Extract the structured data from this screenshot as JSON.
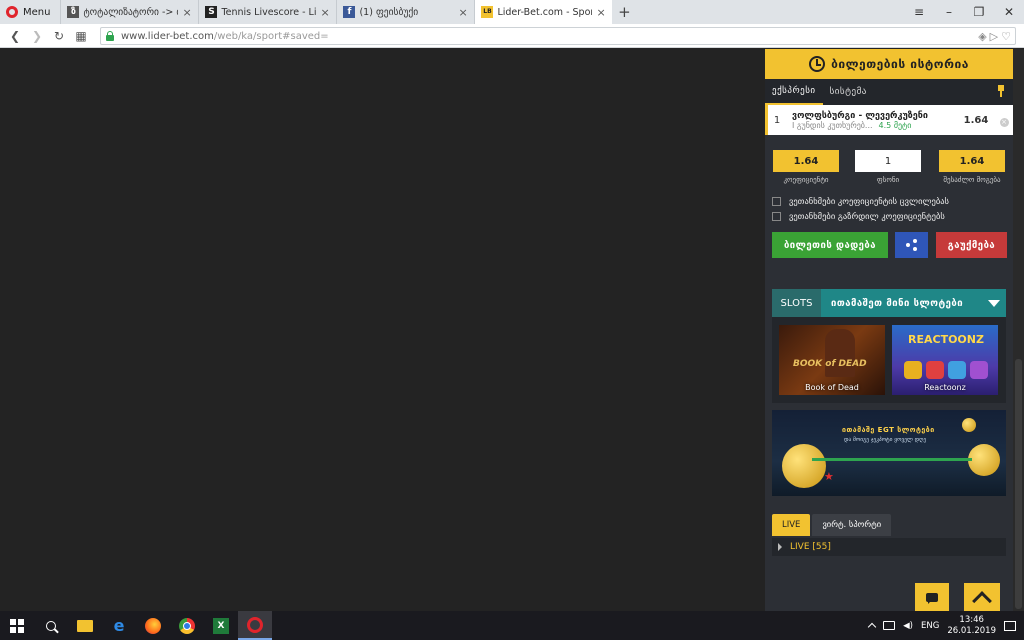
{
  "browser": {
    "menu_label": "Menu",
    "tabs": [
      {
        "title": "ტოტალიზატორი -> თამ",
        "color": "#555555"
      },
      {
        "title": "Tennis Livescore - Live Sco",
        "color": "#222222"
      },
      {
        "title": "(1) ფეისბუქი",
        "color": "#3b5998"
      },
      {
        "title": "Lider-Bet.com - Sports and",
        "color": "#f2c230"
      }
    ],
    "url_host": "www.lider-bet.com",
    "url_path": "/web/ka/sport#saved="
  },
  "betslip": {
    "header_title": "ბილეთების ისტორია",
    "tabs": [
      "ექსპრესი",
      "სისტემა"
    ],
    "selection": {
      "index": "1",
      "match": "ვოლფსბურგი - ლევერკუზენი",
      "market": "I გუნდის კუთხურებ...",
      "line": "4.5 მეტი",
      "odd": "1.64"
    },
    "coef_value": "1.64",
    "stake_value": "1",
    "payout_value": "1.64",
    "coef_label": "კოეფიციენტი",
    "stake_label": "ფსონი",
    "payout_label": "შესაძლო მოგება",
    "check1": "ვეთანხმები კოეფიციენტის ცვლილებას",
    "check2": "ვეთანხმები გაზრდილ კოეფიციენტებს",
    "place_bet": "ბილეთის დადება",
    "cancel": "გაუქმება"
  },
  "slots": {
    "label": "SLOTS",
    "select": "ითამაშეთ მინი სლოტები",
    "games": [
      "Book of Dead",
      "Reactoonz"
    ],
    "game2_logo": "REACTOONZ"
  },
  "promo": {
    "title": "ითამაშე EGT სლოტები",
    "subtitle": "და მოიგე ჯეკპოტი ყოველ დღე"
  },
  "live": {
    "tab_live": "LIVE",
    "tab_virtual": "ვირტ. სპორტი",
    "row_label": "LIVE",
    "row_count": "[55]"
  },
  "taskbar": {
    "lang": "ENG",
    "time": "13:46",
    "date": "26.01.2019"
  },
  "colors": {
    "accent": "#f2c230",
    "green": "#3aa335",
    "blue": "#2f56b8",
    "red": "#c63a3a",
    "teal": "#1f8787"
  }
}
